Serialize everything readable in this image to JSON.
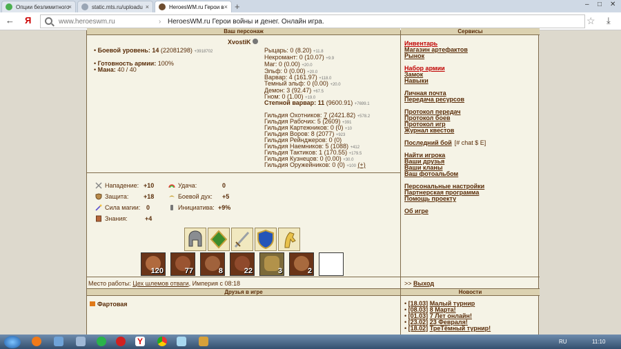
{
  "browser": {
    "tabs": [
      {
        "label": "Опции безлимитного"
      },
      {
        "label": "static.mts.ru/uploadu"
      },
      {
        "label": "HeroesWM.ru Герои в"
      }
    ],
    "url": "www.heroeswm.ru",
    "page_title": "HeroesWM.ru Герои войны и денег. Онлайн игра.",
    "search_glyph": "Я"
  },
  "headers": {
    "character": "Ваш персонаж",
    "services": "Сервисы",
    "friends": "Друзья в игре",
    "news": "Новости"
  },
  "player": {
    "name": "XvostiK",
    "combat_level_label": "Боевой уровень:",
    "combat_level": "14",
    "combat_exp": "(22081298)",
    "combat_exp_delta": "+3918702",
    "army_ready_label": "Готовность армии:",
    "army_ready": "100%",
    "mana_label": "Мана:",
    "mana": "40 / 40"
  },
  "factions": [
    {
      "label": "Рыцарь: 0 (8.20)",
      "delta": "+11.8"
    },
    {
      "label": "Некромант: 0 (10.07)",
      "delta": "+9.9"
    },
    {
      "label": "Маг: 0 (0.00)",
      "delta": "+20.0"
    },
    {
      "label": "Эльф: 0 (0.00)",
      "delta": "+20.0"
    },
    {
      "label": "Варвар: 4 (161.97)",
      "delta": "+118.0"
    },
    {
      "label": "Темный эльф: 0 (0.00)",
      "delta": "+20.0"
    },
    {
      "label": "Демон: 3 (92.47)",
      "delta": "+67.5"
    },
    {
      "label": "Гном: 0 (1.00)",
      "delta": "+19.0"
    }
  ],
  "faction_current": {
    "label": "Степной варвар:",
    "level": "11",
    "points": "(9600.91)",
    "delta": "+7699.1"
  },
  "guilds": [
    {
      "label": "Гильдия Охотников:",
      "value": "7",
      "rest": "(2421.82)",
      "delta": "+578.2"
    },
    {
      "label": "Гильдия Рабочих: 5 (2609)",
      "delta": "+391"
    },
    {
      "label": "Гильдия Картежников: 0 (0)",
      "delta": "+10"
    },
    {
      "label": "Гильдия Воров: 8 (2077)",
      "delta": "+923"
    },
    {
      "label": "Гильдия Рейнджеров: 0 (0)",
      "delta": ""
    },
    {
      "label": "Гильдия Наемников: 5 (1088)",
      "delta": "+412"
    },
    {
      "label": "Гильдия Тактиков: 1 (170.55)",
      "delta": "+179.5"
    },
    {
      "label": "Гильдия Кузнецов: 0 (0.00)",
      "delta": "+30.0"
    },
    {
      "label": "Гильдия Оружейников: 0 (0)",
      "delta": "+100",
      "extra": "(+)"
    }
  ],
  "stats": {
    "attack_label": "Нападение:",
    "attack": "+10",
    "luck_label": "Удача:",
    "luck": "0",
    "defense_label": "Защита:",
    "defense": "+18",
    "morale_label": "Боевой дух:",
    "morale": "+5",
    "spell_label": "Сила магии:",
    "spell": "0",
    "initiative_label": "Инициатива:",
    "initiative": "+9%",
    "knowledge_label": "Знания:",
    "knowledge": "+4"
  },
  "army": [
    "120",
    "77",
    "8",
    "22",
    "3",
    "2",
    ""
  ],
  "work": {
    "label": "Место работы:",
    "place": "Цех шлемов отваги",
    "rest": ", Империя с 08:18"
  },
  "services": [
    {
      "text": "Инвентарь",
      "red": true
    },
    {
      "text": "Магазин артефактов"
    },
    {
      "text": "Рынок"
    },
    {
      "text": ""
    },
    {
      "text": "Набор армии",
      "red": true
    },
    {
      "text": "Замок"
    },
    {
      "text": "Навыки"
    },
    {
      "text": ""
    },
    {
      "text": "Личная почта"
    },
    {
      "text": "Передача ресурсов"
    },
    {
      "text": ""
    },
    {
      "text": "Протокол передач"
    },
    {
      "text": "Протокол боев"
    },
    {
      "text": "Протокол игр"
    },
    {
      "text": "Журнал квестов"
    },
    {
      "text": ""
    },
    {
      "text": "Последний бой",
      "extra": "[#  chat  $  E]"
    },
    {
      "text": ""
    },
    {
      "text": "Найти игрока"
    },
    {
      "text": "Ваши друзья"
    },
    {
      "text": "Ваши кланы"
    },
    {
      "text": "Ваш фотоальбом"
    },
    {
      "text": ""
    },
    {
      "text": "Персональные настройки"
    },
    {
      "text": "Партнерская программа"
    },
    {
      "text": "Помощь проекту"
    },
    {
      "text": ""
    },
    {
      "text": "Об игре"
    }
  ],
  "exit": {
    "prefix": ">>",
    "label": "Выход"
  },
  "friends": [
    {
      "name": "Фартовая"
    }
  ],
  "news": [
    {
      "date": "[18.03]",
      "title": "Малый турнир"
    },
    {
      "date": "[08.03]",
      "title": "8 Марта!"
    },
    {
      "date": "[01.03]",
      "title": "7 Лет онлайн!"
    },
    {
      "date": "[23.02]",
      "title": "23 Февраля!"
    },
    {
      "date": "[18.02]",
      "title": "ТреТёмный турнир!"
    }
  ],
  "taskbar": {
    "lang": "RU",
    "time": "11:10"
  }
}
